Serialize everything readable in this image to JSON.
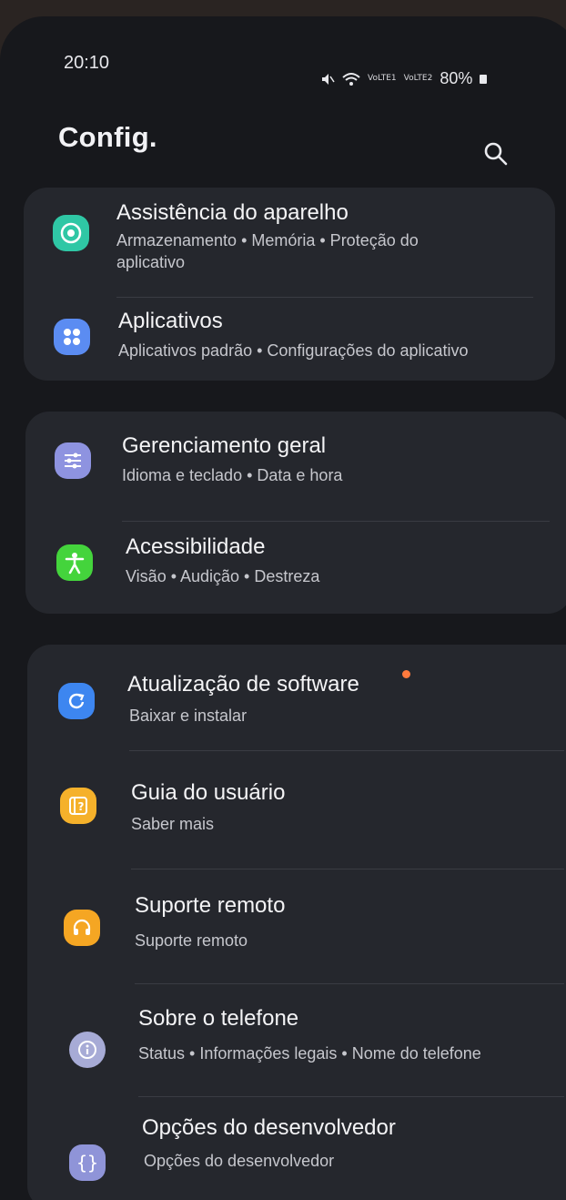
{
  "status": {
    "time": "20:10",
    "sim1": "VoLTE1",
    "sim2": "VoLTE2",
    "battery": "80%"
  },
  "header": {
    "title": "Config."
  },
  "items": [
    {
      "title": "Assistência do aparelho",
      "sub1": "Armazenamento  •  Memória  •  Proteção do",
      "sub2": "aplicativo"
    },
    {
      "title": "Aplicativos",
      "sub1": "Aplicativos padrão  •  Configurações do aplicativo"
    },
    {
      "title": "Gerenciamento geral",
      "sub1": "Idioma e teclado  •  Data e hora"
    },
    {
      "title": "Acessibilidade",
      "sub1": "Visão  •  Audição  •  Destreza"
    },
    {
      "title": "Atualização de software",
      "sub1": "Baixar e instalar"
    },
    {
      "title": "Guia do usuário",
      "sub1": "Saber mais"
    },
    {
      "title": "Suporte remoto",
      "sub1": "Suporte remoto"
    },
    {
      "title": "Sobre o telefone",
      "sub1": "Status  •  Informações legais  •  Nome do telefone"
    },
    {
      "title": "Opções do desenvolvedor",
      "sub1": "Opções do desenvolvedor"
    }
  ],
  "colors": {
    "device_care": "#2fc7a5",
    "apps": "#5b8cf2",
    "general": "#8e93e0",
    "accessibility": "#44d43c",
    "update": "#3d86f0",
    "guide": "#f5b12b",
    "remote": "#f5a623",
    "about": "#a7abd6",
    "developer": "#8f94d8",
    "badge": "#ff7a3d"
  }
}
